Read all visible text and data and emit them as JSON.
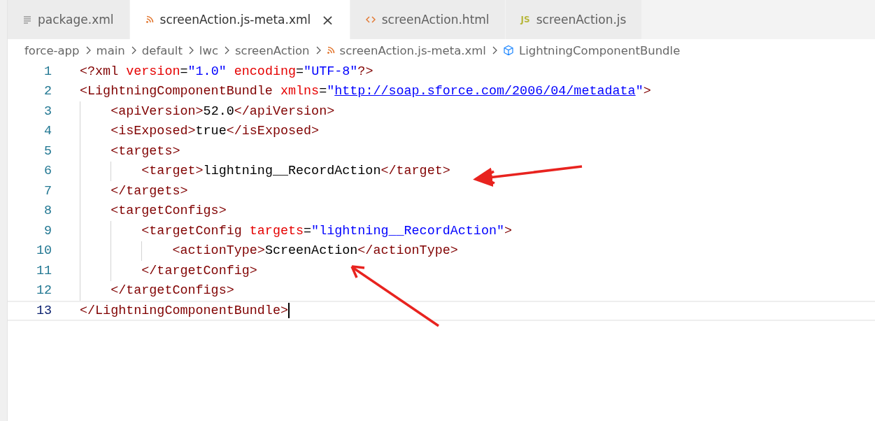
{
  "tabs": [
    {
      "label": "package.xml",
      "kind": "lines",
      "selected": false
    },
    {
      "label": "screenAction.js-meta.xml",
      "kind": "rss",
      "selected": true,
      "close_glyph": "×"
    },
    {
      "label": "screenAction.html",
      "kind": "code",
      "selected": false
    },
    {
      "label": "screenAction.js",
      "kind": "js",
      "icon_text": "JS",
      "selected": false
    }
  ],
  "breadcrumb": [
    {
      "label": "force-app",
      "kind": "folder"
    },
    {
      "label": "main",
      "kind": "folder"
    },
    {
      "label": "default",
      "kind": "folder"
    },
    {
      "label": "lwc",
      "kind": "folder"
    },
    {
      "label": "screenAction",
      "kind": "folder"
    },
    {
      "label": "screenAction.js-meta.xml",
      "kind": "rss"
    },
    {
      "label": "LightningComponentBundle",
      "kind": "cube"
    }
  ],
  "editor": {
    "lines": [
      {
        "number": "1",
        "current": false,
        "tokens": [
          {
            "kind": "tag",
            "text": "<?xml "
          },
          {
            "kind": "attr",
            "text": "version"
          },
          {
            "kind": "text",
            "text": "="
          },
          {
            "kind": "string",
            "text": "\"1.0\""
          },
          {
            "kind": "attr",
            "text": " encoding"
          },
          {
            "kind": "text",
            "text": "="
          },
          {
            "kind": "string",
            "text": "\"UTF-8\""
          },
          {
            "kind": "tag",
            "text": "?>"
          }
        ]
      },
      {
        "number": "2",
        "current": false,
        "tokens": [
          {
            "kind": "tag",
            "text": "<LightningComponentBundle "
          },
          {
            "kind": "attr",
            "text": "xmlns"
          },
          {
            "kind": "text",
            "text": "="
          },
          {
            "kind": "string",
            "text": "\""
          },
          {
            "kind": "link",
            "text": "http://soap.sforce.com/2006/04/metadata"
          },
          {
            "kind": "string",
            "text": "\""
          },
          {
            "kind": "tag",
            "text": ">"
          }
        ]
      },
      {
        "number": "3",
        "current": false,
        "tokens": [
          {
            "kind": "tag",
            "text": "    <apiVersion>"
          },
          {
            "kind": "text",
            "text": "52.0"
          },
          {
            "kind": "tag",
            "text": "</apiVersion>"
          }
        ]
      },
      {
        "number": "4",
        "current": false,
        "tokens": [
          {
            "kind": "tag",
            "text": "    <isExposed>"
          },
          {
            "kind": "text",
            "text": "true"
          },
          {
            "kind": "tag",
            "text": "</isExposed>"
          }
        ]
      },
      {
        "number": "5",
        "current": false,
        "tokens": [
          {
            "kind": "tag",
            "text": "    <targets>"
          }
        ]
      },
      {
        "number": "6",
        "current": false,
        "tokens": [
          {
            "kind": "tag",
            "text": "        <target>"
          },
          {
            "kind": "text",
            "text": "lightning__RecordAction"
          },
          {
            "kind": "tag",
            "text": "</target>"
          }
        ]
      },
      {
        "number": "7",
        "current": false,
        "tokens": [
          {
            "kind": "tag",
            "text": "    </targets>"
          }
        ]
      },
      {
        "number": "8",
        "current": false,
        "tokens": [
          {
            "kind": "tag",
            "text": "    <targetConfigs>"
          }
        ]
      },
      {
        "number": "9",
        "current": false,
        "tokens": [
          {
            "kind": "tag",
            "text": "        <targetConfig "
          },
          {
            "kind": "attr",
            "text": "targets"
          },
          {
            "kind": "text",
            "text": "="
          },
          {
            "kind": "string",
            "text": "\"lightning__RecordAction\""
          },
          {
            "kind": "tag",
            "text": ">"
          }
        ]
      },
      {
        "number": "10",
        "current": false,
        "tokens": [
          {
            "kind": "tag",
            "text": "            <actionType>"
          },
          {
            "kind": "text",
            "text": "ScreenAction"
          },
          {
            "kind": "tag",
            "text": "</actionType>"
          }
        ]
      },
      {
        "number": "11",
        "current": false,
        "tokens": [
          {
            "kind": "tag",
            "text": "        </targetConfig>"
          }
        ]
      },
      {
        "number": "12",
        "current": false,
        "tokens": [
          {
            "kind": "tag",
            "text": "    </targetConfigs>"
          }
        ]
      },
      {
        "number": "13",
        "current": true,
        "tokens": [
          {
            "kind": "tag",
            "text": "</LightningComponentBundle>"
          }
        ]
      }
    ]
  }
}
